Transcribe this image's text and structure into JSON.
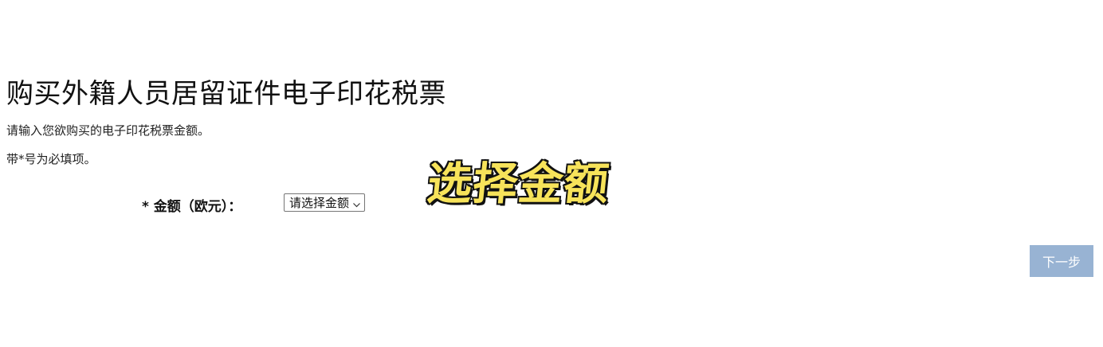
{
  "page": {
    "title": "购买外籍人员居留证件电子印花税票",
    "intro": "请输入您欲购买的电子印花税票金额。",
    "required_note": "带*号为必填项。"
  },
  "form": {
    "amount_label": "* 金额（欧元）：",
    "amount_select_value": "请选择金额"
  },
  "overlay": {
    "caption": "选择金额"
  },
  "actions": {
    "next_label": "下一步"
  },
  "colors": {
    "next_button_bg": "#98b3d3",
    "caption_fill": "#f7e35a",
    "caption_outline": "#111111"
  },
  "icons": {
    "select_arrow": "chevron-down-icon"
  }
}
